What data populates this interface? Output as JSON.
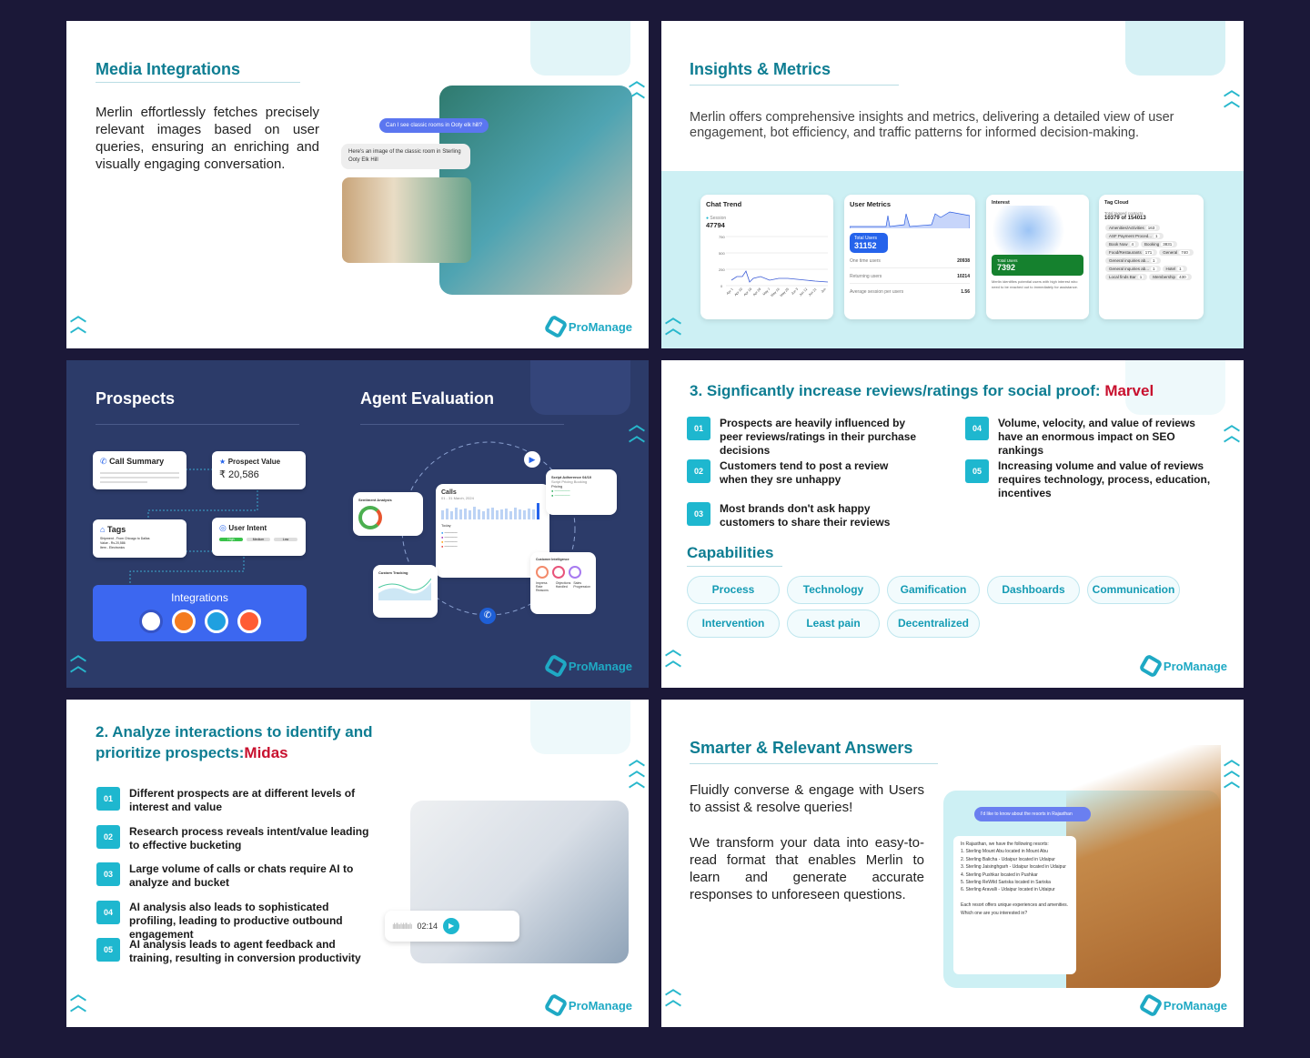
{
  "brand": "ProManage",
  "colors": {
    "accent": "#1fb7cf",
    "heading": "#0e7d92",
    "highlight": "#c8102e",
    "dark": "#2c3b69"
  },
  "slide1": {
    "title": "Media Integrations",
    "body": "Merlin effortlessly fetches precisely relevant images based on user queries, ensuring an enriching and visually engaging conversation.",
    "user_msg": "Can I see classic rooms in Ooty elk hill?",
    "bot_msg": "Here's an image of the classic room in Sterling Ooty Elk Hill"
  },
  "slide2": {
    "title": "Insights & Metrics",
    "body": "Merlin offers comprehensive insights and metrics, delivering a detailed view of user engagement, bot efficiency, and traffic patterns for informed decision-making.",
    "chat_trend": {
      "title": "Chat Trend",
      "legend": "Session",
      "value": "47794",
      "yticks": [
        "750",
        "500",
        "250",
        "0"
      ],
      "xticks": [
        "Apr 1",
        "Apr 10",
        "Apr 19",
        "Apr 28",
        "May 7",
        "May 16",
        "May 25",
        "Jun 3",
        "Jun 12",
        "Jun 21",
        "Jun"
      ]
    },
    "user_metrics": {
      "title": "User Metrics",
      "total_label": "Total Users",
      "total": "31152",
      "rows": [
        {
          "label": "One time users",
          "value": "20938"
        },
        {
          "label": "Returning users",
          "value": "10214"
        },
        {
          "label": "Average session per users",
          "value": "1.56"
        }
      ]
    },
    "interest": {
      "title": "Interest",
      "total_label": "Total Users",
      "total": "7392",
      "desc": "Merlin identifies potential users with high interest who need to be reached out to immediately for assistance."
    },
    "tag_cloud": {
      "title": "Tag Cloud",
      "sub": "Total tagged contacts",
      "value": "10379 of 154013",
      "tags": [
        {
          "t": "Amenities/Activities",
          "n": "163"
        },
        {
          "t": "ASF Payment Proced...",
          "n": "1"
        },
        {
          "t": "Book Now",
          "n": "4"
        },
        {
          "t": "Booking",
          "n": "3831"
        },
        {
          "t": "Food/Restaurants",
          "n": "171"
        },
        {
          "t": "General",
          "n": "740"
        },
        {
          "t": "General inquiries ab...",
          "n": "1"
        },
        {
          "t": "General inquiries ab...",
          "n": "1"
        },
        {
          "t": "Hotel",
          "n": "1"
        },
        {
          "t": "Local finds Bar",
          "n": "1"
        },
        {
          "t": "Membership",
          "n": "430"
        }
      ]
    }
  },
  "slide3": {
    "title_left": "Prospects",
    "title_right": "Agent Evaluation",
    "call_summary": "Call Summary",
    "prospect_value_label": "Prospect Value",
    "prospect_value": "₹ 20,586",
    "tags_label": "Tags",
    "tags_lines": [
      "Shipment - From Chicago to Dallas",
      "Value - Rs.20,586",
      "Item - Electronics"
    ],
    "user_intent": "User Intent",
    "intent_levels": [
      "High",
      "Medium",
      "Low"
    ],
    "integrations": "Integrations",
    "eval": {
      "sentiment": "Sentiment Analysis",
      "calls": "Calls",
      "calls_date": "01 - 31 March, 2024",
      "today": "Today",
      "script": "Script Adherence 04/10",
      "script_tabs": [
        "Script",
        "Pricing",
        "Booking"
      ],
      "pricing": "Pricing",
      "custom": "Custom Tracking",
      "customer": "Customer Intelligence",
      "ci_labels": [
        "Impress Rate Reasons",
        "Objections Handled",
        "Sales Progression"
      ]
    }
  },
  "slide4": {
    "title": "3. Signficantly increase reviews/ratings for social proof: ",
    "title_highlight": "Marvel",
    "points": [
      {
        "n": "01",
        "t": "Prospects are heavily influenced by peer reviews/ratings in their purchase decisions"
      },
      {
        "n": "02",
        "t": "Customers tend to post a review  when they sre unhappy"
      },
      {
        "n": "03",
        "t": "Most brands don't ask happy customers to share their reviews"
      },
      {
        "n": "04",
        "t": "Volume, velocity, and value of reviews have an enormous impact on SEO rankings"
      },
      {
        "n": "05",
        "t": "Increasing volume and value of reviews requires technology, process, education, incentives"
      }
    ],
    "cap_title": "Capabilities",
    "capabilities": [
      "Process",
      "Technology",
      "Gamification",
      "Dashboards",
      "Communication",
      "Intervention",
      "Least pain",
      "Decentralized"
    ]
  },
  "slide5": {
    "title": "2. Analyze interactions to identify and prioritize prospects:",
    "title_highlight": "Midas",
    "points": [
      {
        "n": "01",
        "t": "Different prospects are at different levels of interest and value"
      },
      {
        "n": "02",
        "t": "Research process reveals intent/value leading to effective bucketing"
      },
      {
        "n": "03",
        "t": "Large volume of calls or chats require AI to analyze and bucket"
      },
      {
        "n": "04",
        "t": "AI analysis also leads to sophisticated profiling, leading to productive outbound engagement"
      },
      {
        "n": "05",
        "t": "AI analysis leads to agent feedback and training, resulting in conversion productivity"
      }
    ],
    "audio_time": "02:14"
  },
  "slide6": {
    "title": "Smarter & Relevant Answers",
    "body1": "Fluidly converse & engage with Users to assist & resolve queries!",
    "body2": "We transform your data into easy-to-read format that enables Merlin to learn and generate accurate responses to unforeseen questions.",
    "user_msg": "I'd like to know about the resorts in Rajasthan",
    "bot_msg": "In Rajasthan, we have the following resorts:\n1. Sterling Mount Abu located in Mount Abu\n2. Sterling Balicha - Udaipur located in Udaipur\n3. Sterling Jaisinghgarh - Udaipur located in Udaipur\n4. Sterling Pushkar located in Pushkar\n5. Sterling ReWild Sariska located in Sariska\n6. Sterling Aravalli - Udaipur located in Udaipur\n\nEach resort offers unique experiences and amenities. Which one are you interested in?"
  }
}
